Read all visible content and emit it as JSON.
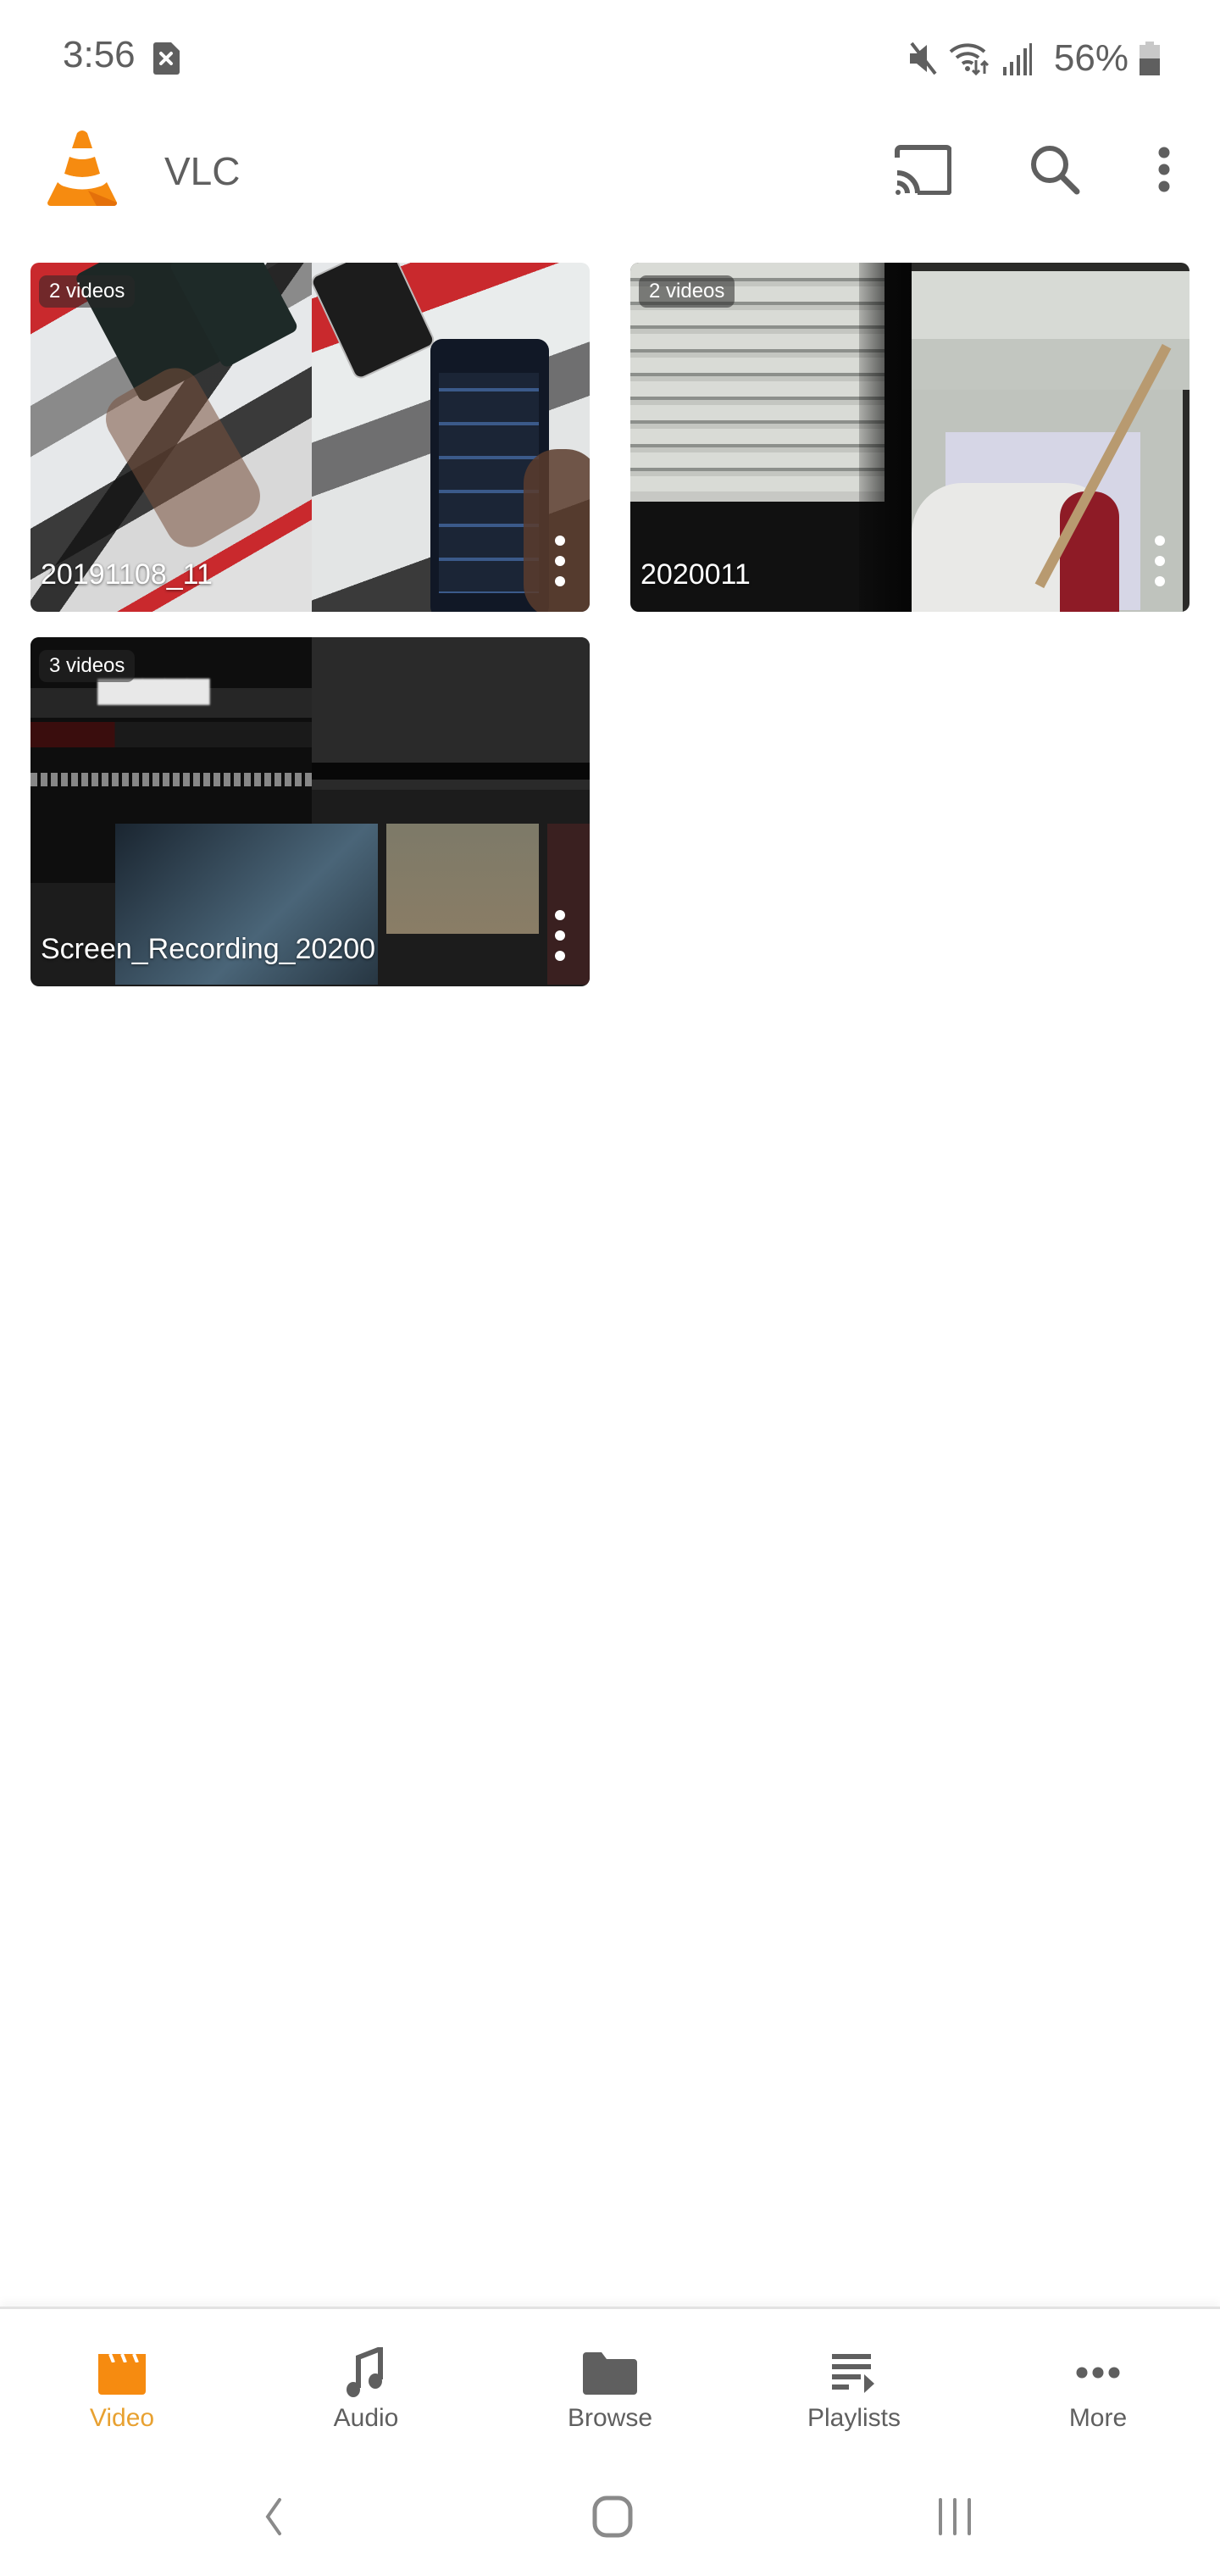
{
  "status_bar": {
    "time": "3:56",
    "left_icons": [
      "sim-error-icon"
    ],
    "right_icons": [
      "mute-icon",
      "wifi-icon",
      "signal-icon",
      "battery-icon"
    ],
    "battery": "56%"
  },
  "app_bar": {
    "logo": "vlc-cone-logo",
    "title": "VLC",
    "actions": [
      "cast-icon",
      "search-icon",
      "more-vert-icon"
    ]
  },
  "folders": [
    {
      "badge": "2 videos",
      "title": "20191108_11"
    },
    {
      "badge": "2 videos",
      "title": "2020011"
    },
    {
      "badge": "3 videos",
      "title": "Screen_Recording_20200"
    }
  ],
  "bottom_nav": {
    "active_color": "#f68b10",
    "items": [
      {
        "label": "Video",
        "icon": "video-clapper-icon",
        "active": true
      },
      {
        "label": "Audio",
        "icon": "music-note-icon",
        "active": false
      },
      {
        "label": "Browse",
        "icon": "folder-icon",
        "active": false
      },
      {
        "label": "Playlists",
        "icon": "playlist-icon",
        "active": false
      },
      {
        "label": "More",
        "icon": "more-horiz-icon",
        "active": false
      }
    ]
  },
  "system_nav": [
    "back-icon",
    "home-icon",
    "recents-icon"
  ]
}
